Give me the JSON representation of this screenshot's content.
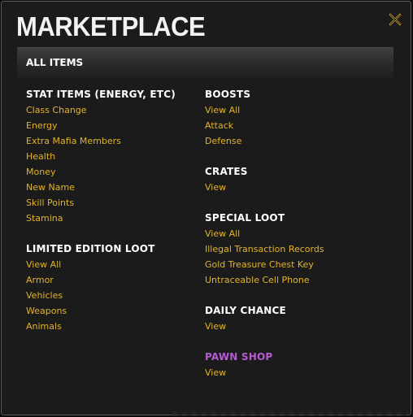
{
  "dialog": {
    "title": "MARKETPLACE",
    "close_icon": "close-x-icon",
    "section_label": "ALL ITEMS"
  },
  "left_column": [
    {
      "title": "STAT ITEMS (ENERGY, ETC)",
      "links": [
        "Class Change",
        "Energy",
        "Extra Mafia Members",
        "Health",
        "Money",
        "New Name",
        "Skill Points",
        "Stamina"
      ]
    },
    {
      "title": "LIMITED EDITION LOOT",
      "links": [
        "View All",
        "Armor",
        "Vehicles",
        "Weapons",
        "Animals"
      ]
    }
  ],
  "right_column": [
    {
      "title": "BOOSTS",
      "links": [
        "View All",
        "Attack",
        "Defense"
      ]
    },
    {
      "title": "CRATES",
      "links": [
        "View"
      ]
    },
    {
      "title": "SPECIAL LOOT",
      "links": [
        "View All",
        "Illegal Transaction Records",
        "Gold Treasure Chest Key",
        "Untraceable Cell Phone"
      ]
    },
    {
      "title": "DAILY CHANCE",
      "links": [
        "View"
      ]
    },
    {
      "title": "PAWN SHOP",
      "links": [
        "View"
      ]
    }
  ],
  "colors": {
    "link": "#e3b427",
    "pawn_shop_title": "#b95bd6",
    "heading": "#ffffff",
    "background": "#1b1b1b"
  }
}
